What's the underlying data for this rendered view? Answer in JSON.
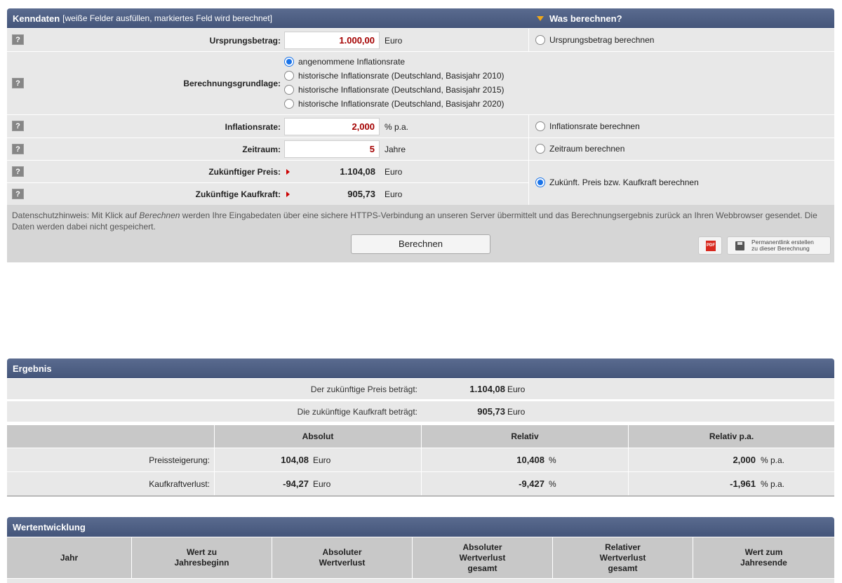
{
  "kenndaten": {
    "title": "Kenndaten",
    "subtitle": "[weiße Felder ausfüllen, markiertes Feld wird berechnet]",
    "was_berechnen": "Was berechnen?",
    "help_label": "?",
    "ursprungsbetrag": {
      "label": "Ursprungsbetrag:",
      "value": "1.000,00",
      "unit": "Euro",
      "calc_option": "Ursprungsbetrag berechnen"
    },
    "berechnungsgrundlage": {
      "label": "Berechnungsgrundlage:",
      "options": [
        "angenommene Inflationsrate",
        "historische Inflationsrate (Deutschland, Basisjahr 2010)",
        "historische Inflationsrate (Deutschland, Basisjahr 2015)",
        "historische Inflationsrate (Deutschland, Basisjahr 2020)"
      ],
      "selected_index": 0
    },
    "inflationsrate": {
      "label": "Inflationsrate:",
      "value": "2,000",
      "unit": "% p.a.",
      "calc_option": "Inflationsrate berechnen"
    },
    "zeitraum": {
      "label": "Zeitraum:",
      "value": "5",
      "unit": "Jahre",
      "calc_option": "Zeitraum berechnen"
    },
    "zukuenftiger_preis": {
      "label": "Zukünftiger Preis:",
      "value": "1.104,08",
      "unit": "Euro"
    },
    "zukuenftige_kaufkraft": {
      "label": "Zukünftige Kaufkraft:",
      "value": "905,73",
      "unit": "Euro"
    },
    "preis_kaufkraft_option": "Zukünft. Preis bzw. Kaufkraft berechnen",
    "datenschutz_pre": "Datenschutzhinweis: Mit Klick auf ",
    "datenschutz_em": "Berechnen",
    "datenschutz_post": " werden Ihre Eingabedaten über eine sichere HTTPS-Verbindung an unseren Server übermittelt und das Berechnungsergebnis zurück an Ihren Webbrowser gesendet. Die Daten werden dabei nicht gespeichert.",
    "berechnen_button": "Berechnen",
    "pdf_icon_label": "PDF",
    "permalink_line1": "Permanentlink erstellen",
    "permalink_line2": "zu dieser Berechnung"
  },
  "ergebnis": {
    "title": "Ergebnis",
    "preis_label": "Der zukünftige Preis beträgt:",
    "preis_value": "1.104,08",
    "kaufkraft_label": "Die zukünftige Kaufkraft beträgt:",
    "kaufkraft_value": "905,73",
    "unit_euro": "Euro",
    "columns": [
      "Absolut",
      "Relativ",
      "Relativ p.a."
    ],
    "rows": [
      {
        "label": "Preissteigerung:",
        "absolut": "104,08",
        "absolut_unit": "Euro",
        "relativ": "10,408",
        "relativ_unit": "%",
        "relativ_pa": "2,000",
        "relativ_pa_unit": "% p.a."
      },
      {
        "label": "Kaufkraftverlust:",
        "absolut": "-94,27",
        "absolut_unit": "Euro",
        "relativ": "-9,427",
        "relativ_unit": "%",
        "relativ_pa": "-1,961",
        "relativ_pa_unit": "% p.a."
      }
    ]
  },
  "wertentwicklung": {
    "title": "Wertentwicklung",
    "columns": [
      [
        "Jahr"
      ],
      [
        "Wert zu",
        "Jahresbeginn"
      ],
      [
        "Absoluter",
        "Wertverlust"
      ],
      [
        "Absoluter",
        "Wertverlust",
        "gesamt"
      ],
      [
        "Relativer",
        "Wertverlust",
        "gesamt"
      ],
      [
        "Wert zum",
        "Jahresende"
      ]
    ]
  }
}
